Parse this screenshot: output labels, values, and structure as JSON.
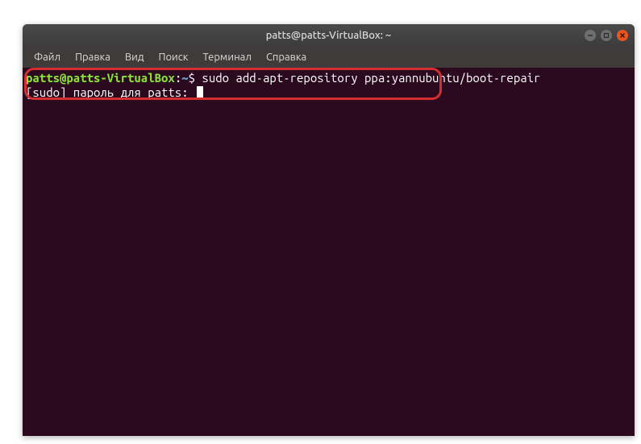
{
  "titlebar": {
    "title": "patts@patts-VirtualBox: ~"
  },
  "menubar": {
    "items": [
      {
        "label": "Файл"
      },
      {
        "label": "Правка"
      },
      {
        "label": "Вид"
      },
      {
        "label": "Поиск"
      },
      {
        "label": "Терминал"
      },
      {
        "label": "Справка"
      }
    ]
  },
  "terminal": {
    "prompt_user": "patts@patts-VirtualBox",
    "prompt_colon": ":",
    "prompt_path": "~",
    "prompt_sign": "$",
    "command": " sudo add-apt-repository ppa:yannubuntu/boot-repair",
    "sudo_line": "[sudo] пароль для patts: "
  }
}
